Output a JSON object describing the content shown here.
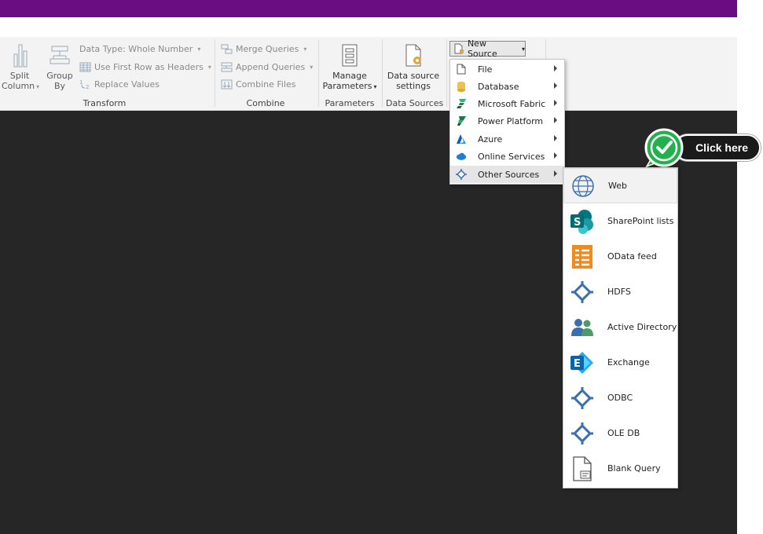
{
  "ribbon": {
    "transform": {
      "split_column": "Split Column",
      "split_column_l1": "Split",
      "split_column_l2": "Column",
      "group_by_l1": "Group",
      "group_by_l2": "By",
      "data_type": "Data Type: Whole Number",
      "first_row": "Use First Row as Headers",
      "replace_values": "Replace Values",
      "label": "Transform"
    },
    "combine": {
      "merge": "Merge Queries",
      "append": "Append Queries",
      "combine_files": "Combine Files",
      "label": "Combine"
    },
    "parameters": {
      "manage_l1": "Manage",
      "manage_l2": "Parameters",
      "label": "Parameters"
    },
    "data_sources": {
      "settings_l1": "Data source",
      "settings_l2": "settings",
      "label": "Data Sources"
    },
    "new_source": "New Source"
  },
  "new_source_menu": [
    {
      "label": "File",
      "icon": "file-icon"
    },
    {
      "label": "Database",
      "icon": "database-icon"
    },
    {
      "label": "Microsoft Fabric",
      "icon": "fabric-icon"
    },
    {
      "label": "Power Platform",
      "icon": "power-platform-icon"
    },
    {
      "label": "Azure",
      "icon": "azure-icon"
    },
    {
      "label": "Online Services",
      "icon": "cloud-icon"
    },
    {
      "label": "Other Sources",
      "icon": "connector-icon"
    }
  ],
  "other_sources_menu": [
    {
      "label": "Web",
      "icon": "globe-icon"
    },
    {
      "label": "SharePoint lists",
      "icon": "sharepoint-icon"
    },
    {
      "label": "OData feed",
      "icon": "odata-icon"
    },
    {
      "label": "HDFS",
      "icon": "connector-icon"
    },
    {
      "label": "Active Directory",
      "icon": "users-icon"
    },
    {
      "label": "Exchange",
      "icon": "exchange-icon"
    },
    {
      "label": "ODBC",
      "icon": "connector-icon"
    },
    {
      "label": "OLE DB",
      "icon": "connector-icon"
    },
    {
      "label": "Blank Query",
      "icon": "blank-query-icon"
    }
  ],
  "callout": {
    "text": "Click here"
  },
  "colors": {
    "title_bar": "#6a0c82",
    "canvas": "#262626",
    "callout_green": "#22b14c"
  }
}
